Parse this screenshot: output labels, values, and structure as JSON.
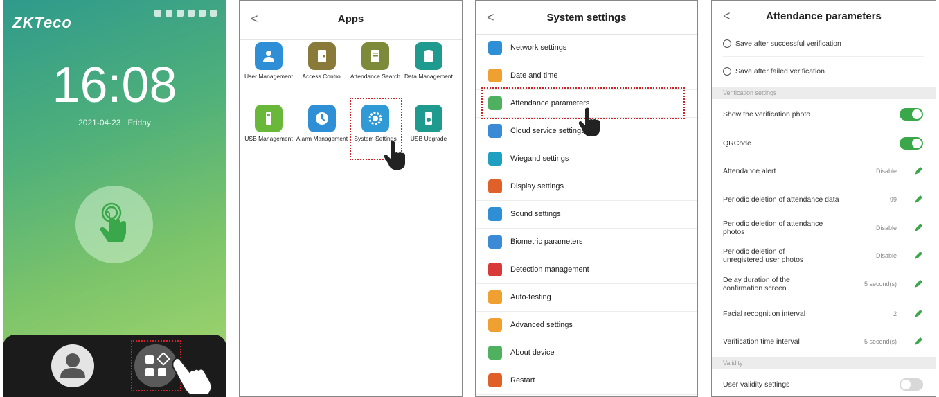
{
  "home": {
    "brand": "ZKTeco",
    "time": "16:08",
    "date": "2021-04-23",
    "weekday": "Friday"
  },
  "apps_screen": {
    "title": "Apps",
    "back": "<",
    "apps": [
      {
        "label": "User Management",
        "icon": "user-icon",
        "color": "#2f8fd6"
      },
      {
        "label": "Access Control",
        "icon": "door-icon",
        "color": "#8a7a3a"
      },
      {
        "label": "Attendance Search",
        "icon": "document-icon",
        "color": "#7c8a3a"
      },
      {
        "label": "Data Management",
        "icon": "database-icon",
        "color": "#1f9a8f"
      },
      {
        "label": "USB Management",
        "icon": "usb-icon",
        "color": "#6ab83a"
      },
      {
        "label": "Alarm Management",
        "icon": "clock-icon",
        "color": "#2f8fd6"
      },
      {
        "label": "System Settings",
        "icon": "gear-icon",
        "color": "#2f9ad6"
      },
      {
        "label": "USB Upgrade",
        "icon": "usb-upgrade-icon",
        "color": "#1f9a8f"
      }
    ]
  },
  "system_settings": {
    "title": "System settings",
    "back": "<",
    "items": [
      {
        "label": "Network settings",
        "color": "#2f8fd6"
      },
      {
        "label": "Date and time",
        "color": "#f0a030"
      },
      {
        "label": "Attendance parameters",
        "color": "#4fb060"
      },
      {
        "label": "Cloud service settings",
        "color": "#3a8ad6"
      },
      {
        "label": "Wiegand settings",
        "color": "#1fa0c0"
      },
      {
        "label": "Display settings",
        "color": "#e0602a"
      },
      {
        "label": "Sound settings",
        "color": "#2f8fd6"
      },
      {
        "label": "Biometric parameters",
        "color": "#3a8ad6"
      },
      {
        "label": "Detection management",
        "color": "#d83a3a"
      },
      {
        "label": "Auto-testing",
        "color": "#f0a030"
      },
      {
        "label": "Advanced settings",
        "color": "#f0a030"
      },
      {
        "label": "About device",
        "color": "#4fb060"
      },
      {
        "label": "Restart",
        "color": "#e0602a"
      }
    ]
  },
  "attendance": {
    "title": "Attendance parameters",
    "back": "<",
    "radio1": "Save after successful verification",
    "radio2": "Save after failed verification",
    "section_verification": "Verification settings",
    "show_photo": "Show the verification photo",
    "qrcode": "QRCode",
    "rows": [
      {
        "label": "Attendance alert",
        "value": "Disable"
      },
      {
        "label": "Periodic deletion of attendance data",
        "value": "99"
      },
      {
        "label": "Periodic deletion of attendance photos",
        "value": "Disable"
      },
      {
        "label": "Periodic deletion of unregistered user photos",
        "value": "Disable"
      },
      {
        "label": "Delay duration of the confirmation screen",
        "value": "5 second(s)"
      },
      {
        "label": "Facial recognition interval",
        "value": "2"
      },
      {
        "label": "Verification time interval",
        "value": "5 second(s)"
      }
    ],
    "section_validity": "Validity",
    "user_validity": "User validity settings",
    "toggles": {
      "show_photo": true,
      "qrcode": true,
      "user_validity": false
    },
    "accent": "#3aa84a"
  }
}
